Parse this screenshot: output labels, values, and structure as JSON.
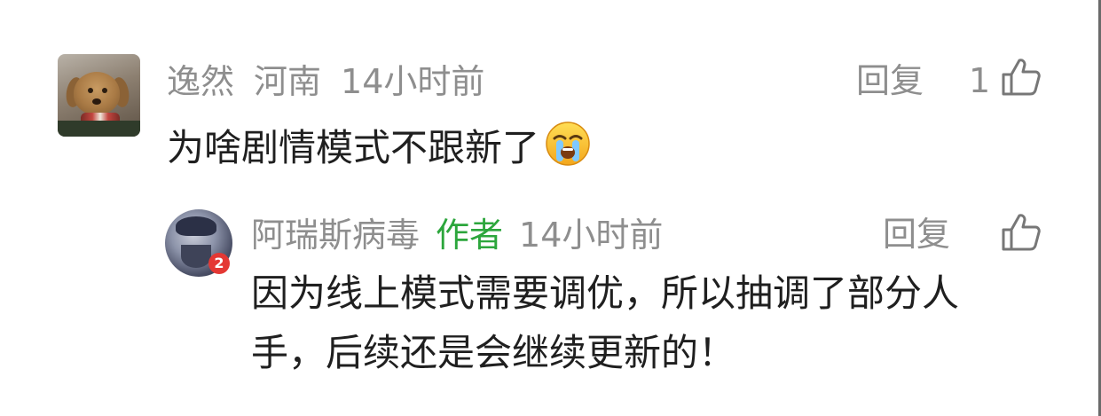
{
  "top_comment": {
    "username": "逸然",
    "location": "河南",
    "time": "14小时前",
    "reply_label": "回复",
    "like_count": "1",
    "text": "为啥剧情模式不跟新了",
    "emoji": "crying-emoji"
  },
  "reply": {
    "username": "阿瑞斯病毒",
    "author_tag": "作者",
    "time": "14小时前",
    "reply_label": "回复",
    "badge": "2",
    "text_line_1": "因为线上模式需要调优，所以抽调了部分人",
    "text_line_2": "手，后续还是会继续更新的！"
  },
  "colors": {
    "meta_gray": "#8e8e8e",
    "text_dark": "#1f1f1f",
    "author_green": "#2ca63c",
    "badge_red": "#e43834"
  }
}
